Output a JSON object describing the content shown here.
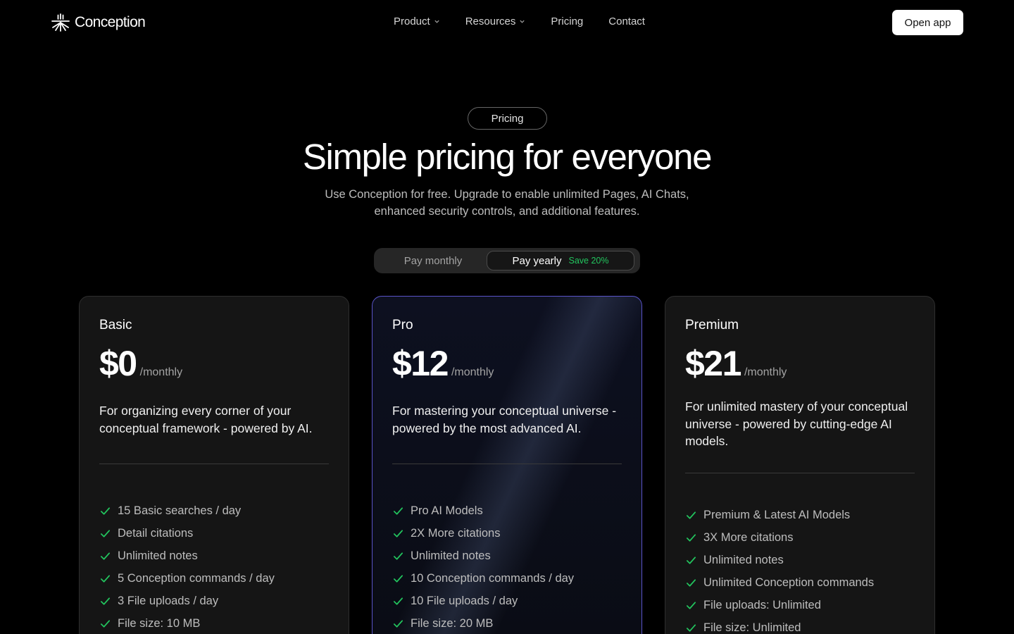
{
  "nav": {
    "brand": "Conception",
    "links": [
      {
        "label": "Product",
        "has_menu": true
      },
      {
        "label": "Resources",
        "has_menu": true
      },
      {
        "label": "Pricing",
        "has_menu": false
      },
      {
        "label": "Contact",
        "has_menu": false
      }
    ],
    "cta": "Open app"
  },
  "hero": {
    "badge": "Pricing",
    "title": "Simple pricing for everyone",
    "subtitle": "Use Conception for free. Upgrade to enable unlimited Pages, AI Chats, enhanced security controls, and additional features."
  },
  "billing_toggle": {
    "monthly_label": "Pay monthly",
    "yearly_label": "Pay yearly",
    "yearly_badge": "Save 20%",
    "selected": "yearly"
  },
  "colors": {
    "accent_check": "#22c55e",
    "pro_border": "#5a54c9"
  },
  "plans": [
    {
      "name": "Basic",
      "price": "$0",
      "period": "/monthly",
      "description": "For organizing every corner of your conceptual framework - powered by AI.",
      "features": [
        "15 Basic searches / day",
        "Detail citations",
        "Unlimited notes",
        "5 Conception commands / day",
        "3 File uploads / day",
        "File size: 10 MB"
      ]
    },
    {
      "name": "Pro",
      "price": "$12",
      "period": "/monthly",
      "description": "For mastering your conceptual universe - powered by the most advanced AI.",
      "features": [
        "Pro AI Models",
        "2X More citations",
        "Unlimited notes",
        "10 Conception commands / day",
        "10 File uploads / day",
        "File size: 20 MB"
      ]
    },
    {
      "name": "Premium",
      "price": "$21",
      "period": "/monthly",
      "description": "For unlimited mastery of your conceptual universe - powered by cutting-edge AI models.",
      "features": [
        "Premium & Latest AI Models",
        "3X More citations",
        "Unlimited notes",
        "Unlimited Conception commands",
        "File uploads: Unlimited",
        "File size: Unlimited"
      ]
    }
  ]
}
